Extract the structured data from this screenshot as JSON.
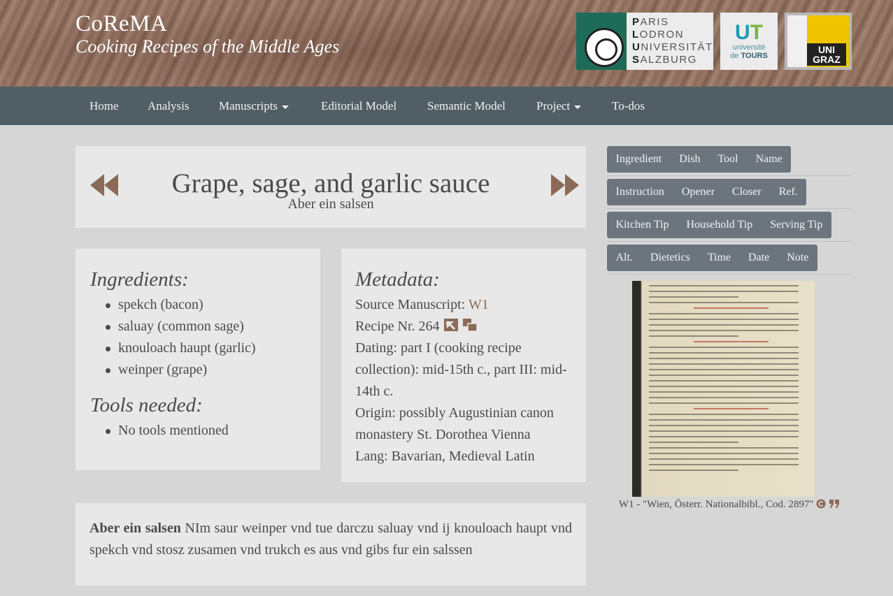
{
  "site": {
    "title": "CoReMA",
    "subtitle": "Cooking Recipes of the Middle Ages"
  },
  "logos": {
    "plus": [
      "ARIS",
      "ODRON",
      "NIVERSITÄT",
      "ALZBURG"
    ],
    "plus_initials": [
      "P",
      "L",
      "U",
      "S"
    ],
    "tours_line1": "université",
    "tours_line2a": "de",
    "tours_line2b": "TOURS",
    "graz": [
      "UNI",
      "GRAZ"
    ]
  },
  "nav": {
    "items": [
      "Home",
      "Analysis",
      "Manuscripts",
      "Editorial Model",
      "Semantic Model",
      "Project",
      "To-dos"
    ]
  },
  "recipe": {
    "title": "Grape, sage, and garlic sauce",
    "original_title": "Aber ein salsen",
    "text_incipit": "Aber ein salsen",
    "text_body": " NIm saur weinper vnd tue darczu saluay vnd ij knouloach haupt vnd spekch vnd stosz zusamen vnd trukch es aus vnd gibs fur ein salssen"
  },
  "ingredients": {
    "heading": "Ingredients:",
    "items": [
      "spekch (bacon)",
      "saluay (common sage)",
      "knouloach haupt (garlic)",
      "weinper (grape)"
    ]
  },
  "tools": {
    "heading": "Tools needed:",
    "items": [
      "No tools mentioned"
    ]
  },
  "metadata": {
    "heading": "Metadata:",
    "source_label": "Source Manuscript: ",
    "source_value": "W1",
    "recipe_nr": "Recipe Nr. 264",
    "dating": "Dating: part I (cooking recipe collection): mid-15th c., part III: mid-14th c.",
    "origin": "Origin: possibly Augustinian canon monastery St. Dorothea Vienna",
    "lang": "Lang: Bavarian, Medieval Latin"
  },
  "filters": {
    "row1": [
      "Ingredient",
      "Dish",
      "Tool",
      "Name"
    ],
    "row2": [
      "Instruction",
      "Opener",
      "Closer",
      "Ref."
    ],
    "row3": [
      "Kitchen Tip",
      "Household Tip",
      "Serving Tip"
    ],
    "row4": [
      "Alt.",
      "Dietetics",
      "Time",
      "Date",
      "Note"
    ]
  },
  "image": {
    "caption": "W1 - \"Wien, Österr. Nationalbibl., Cod. 2897\""
  },
  "colors": {
    "nav_bg": "#525e65",
    "panel_bg": "#e8e8e8",
    "page_bg": "#d6d6d6",
    "accent_brown": "#8b6a58",
    "button_bg": "#6c757d"
  }
}
